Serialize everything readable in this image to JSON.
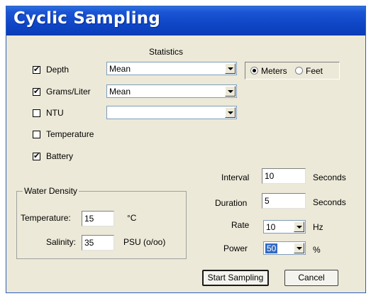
{
  "window": {
    "title": "Cyclic Sampling"
  },
  "statistics": {
    "header": "Statistics",
    "rows": [
      {
        "label": "Depth",
        "checked": true,
        "stat": "Mean"
      },
      {
        "label": "Grams/Liter",
        "checked": true,
        "stat": "Mean"
      },
      {
        "label": "NTU",
        "checked": false,
        "stat": ""
      },
      {
        "label": "Temperature",
        "checked": false
      },
      {
        "label": "Battery",
        "checked": true
      }
    ]
  },
  "units": {
    "meters": "Meters",
    "feet": "Feet",
    "selected": "Meters"
  },
  "water_density": {
    "legend": "Water Density",
    "temperature_label": "Temperature:",
    "temperature_value": "15",
    "temperature_unit": "°C",
    "salinity_label": "Salinity:",
    "salinity_value": "35",
    "salinity_unit": "PSU (o/oo)"
  },
  "timing": {
    "interval_label": "Interval",
    "interval_value": "10",
    "interval_unit": "Seconds",
    "duration_label": "Duration",
    "duration_value": "5",
    "duration_unit": "Seconds",
    "rate_label": "Rate",
    "rate_value": "10",
    "rate_unit": "Hz",
    "power_label": "Power",
    "power_value": "50",
    "power_unit": "%"
  },
  "buttons": {
    "start": "Start Sampling",
    "cancel": "Cancel"
  }
}
